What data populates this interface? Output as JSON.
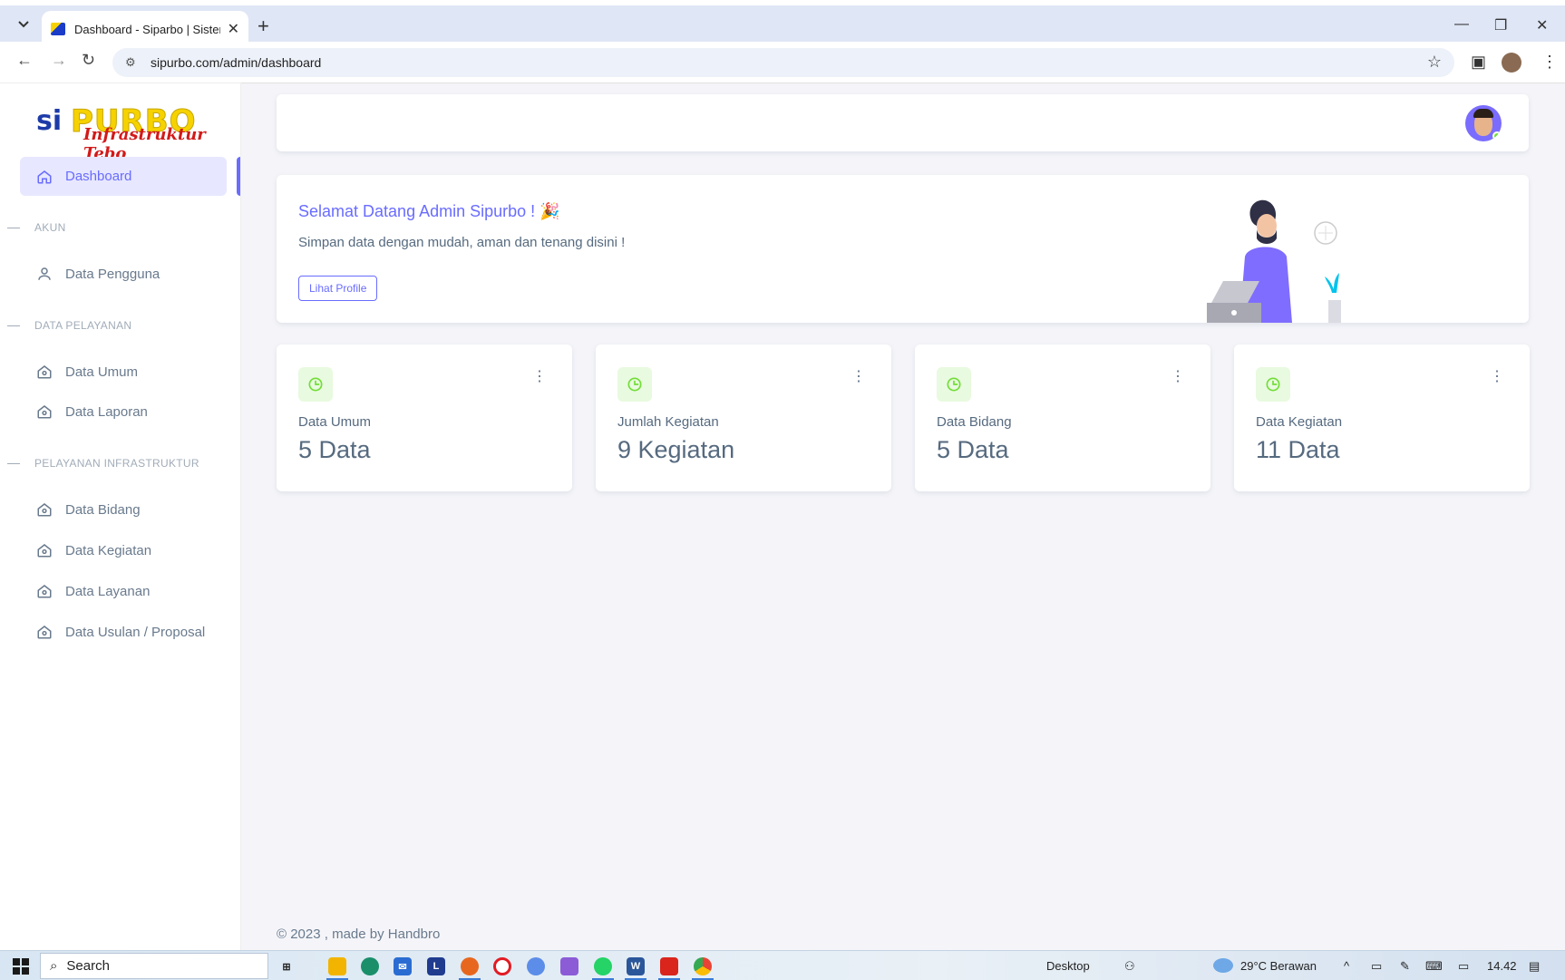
{
  "browser": {
    "tab_title": "Dashboard - Siparbo | Sistem In",
    "url": "sipurbo.com/admin/dashboard"
  },
  "sidebar": {
    "logo": {
      "part1": "si",
      "part2": "PURBO",
      "tagline": "Infrastruktur Tebo"
    },
    "active_item": "Dashboard",
    "sections": [
      {
        "title": "AKUN",
        "items": [
          "Data Pengguna"
        ]
      },
      {
        "title": "DATA PELAYANAN",
        "items": [
          "Data Umum",
          "Data Laporan"
        ]
      },
      {
        "title": "PELAYANAN INFRASTRUKTUR",
        "items": [
          "Data Bidang",
          "Data Kegiatan",
          "Data Layanan",
          "Data Usulan / Proposal"
        ]
      }
    ]
  },
  "welcome": {
    "title": "Selamat Datang Admin Sipurbo !",
    "emoji": "🎉",
    "text": "Simpan data dengan mudah, aman dan tenang disini !",
    "button": "Lihat Profile"
  },
  "stats": [
    {
      "label": "Data Umum",
      "value": "5 Data"
    },
    {
      "label": "Jumlah Kegiatan",
      "value": "9 Kegiatan"
    },
    {
      "label": "Data Bidang",
      "value": "5 Data"
    },
    {
      "label": "Data Kegiatan",
      "value": "11 Data"
    }
  ],
  "footer": "© 2023 , made by Handbro",
  "taskbar": {
    "search": "Search",
    "desktop": "Desktop",
    "weather": "29°C  Berawan",
    "time": "14.42"
  },
  "colors": {
    "primary": "#696cff",
    "success": "#71dd37",
    "muted": "#697a8d"
  }
}
